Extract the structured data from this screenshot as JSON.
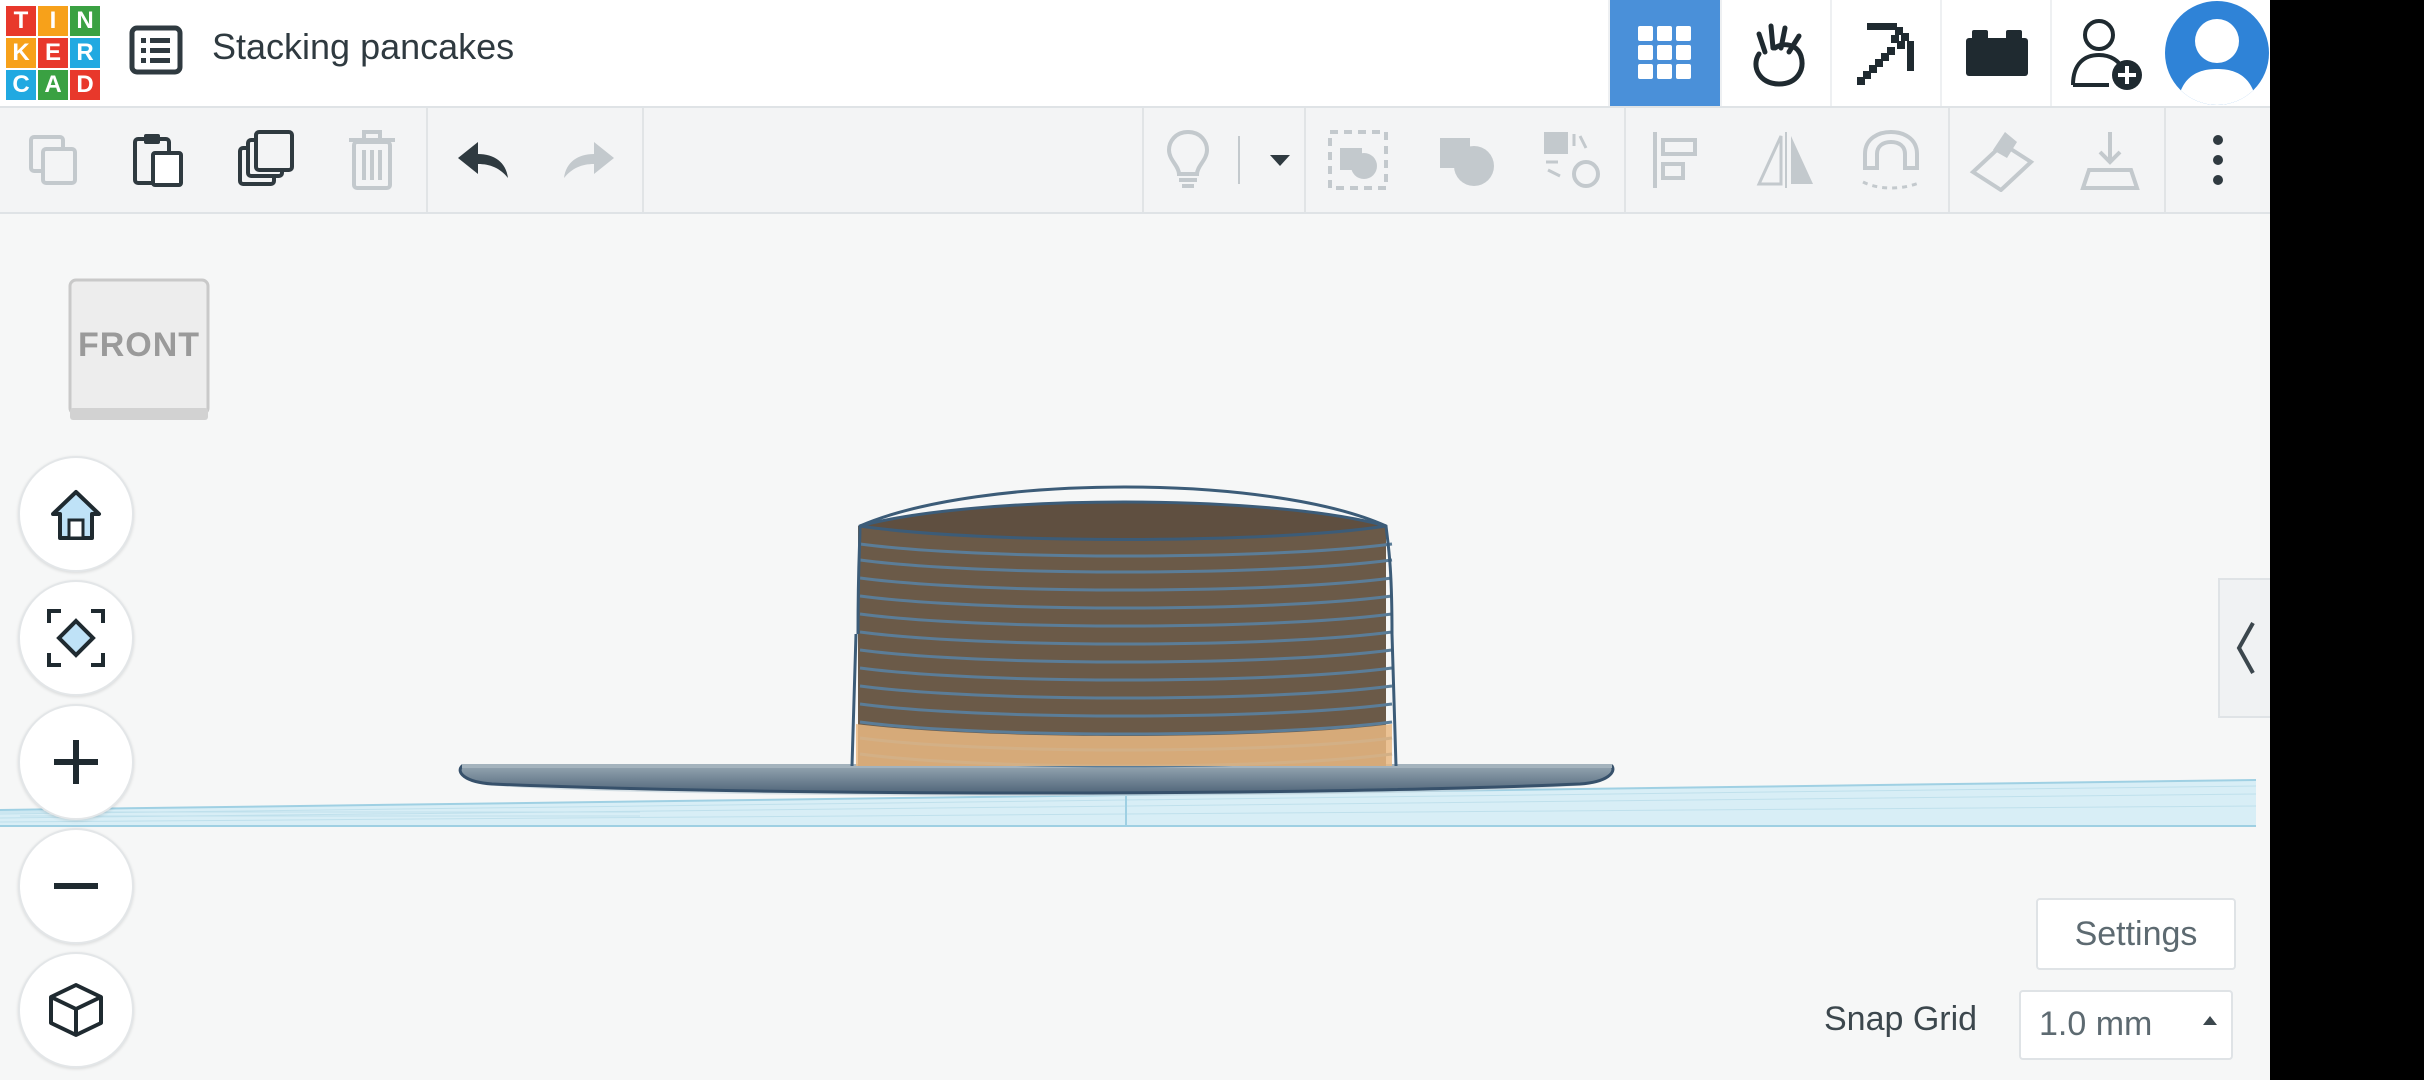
{
  "app": {
    "logo_letters": [
      "T",
      "I",
      "N",
      "K",
      "E",
      "R",
      "C",
      "A",
      "D"
    ],
    "logo_colors": [
      "#e8382b",
      "#f7a11a",
      "#3aa142",
      "#f7a11a",
      "#e8382b",
      "#21a9e1",
      "#21a9e1",
      "#3aa142",
      "#e8382b"
    ],
    "project_title": "Stacking pancakes"
  },
  "header_buttons": [
    {
      "name": "3d-design-view",
      "icon": "grid-icon",
      "active": true
    },
    {
      "name": "simulate",
      "icon": "hand-icon"
    },
    {
      "name": "minecraft",
      "icon": "pickaxe-icon"
    },
    {
      "name": "bricks",
      "icon": "brick-icon"
    },
    {
      "name": "invite",
      "icon": "add-user-icon"
    }
  ],
  "toolbar": {
    "items": [
      "copy-icon",
      "paste-icon",
      "duplicate-icon",
      "trash-icon",
      "undo-icon",
      "redo-icon",
      "note-light-icon",
      "dropdown-icon",
      "group-icon",
      "ungroup-icon",
      "cruise-icon",
      "align-icon",
      "mirror-icon",
      "magnet-icon",
      "workplane-icon",
      "ruler-icon",
      "more-icon"
    ]
  },
  "viewport": {
    "view_cube_label": "FRONT",
    "settings_label": "Settings",
    "snap_grid_label": "Snap Grid",
    "snap_grid_value": "1.0 mm",
    "pancake_color": "#e9b883",
    "plate_color": "#6e8596",
    "workplane_color": "#d8eef6"
  }
}
